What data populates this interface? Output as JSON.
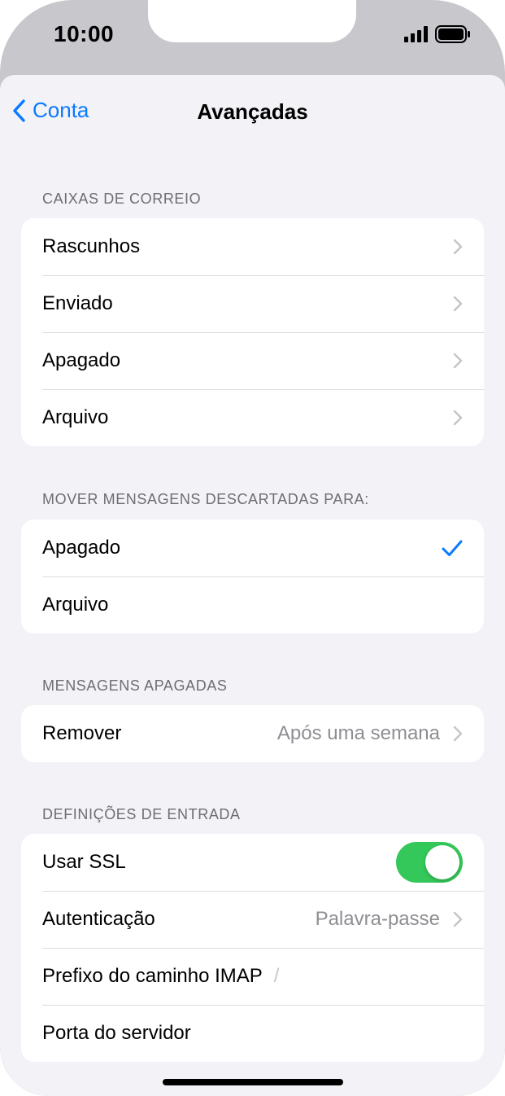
{
  "status_bar": {
    "time": "10:00"
  },
  "nav": {
    "back_label": "Conta",
    "title": "Avançadas"
  },
  "sections": [
    {
      "header": "CAIXAS DE CORREIO",
      "rows": [
        "Rascunhos",
        "Enviado",
        "Apagado",
        "Arquivo"
      ]
    },
    {
      "header": "MOVER MENSAGENS DESCARTADAS PARA:",
      "rows": [
        "Apagado",
        "Arquivo"
      ],
      "selected": "Apagado"
    },
    {
      "header": "MENSAGENS APAGADAS",
      "rows": [
        {
          "label": "Remover",
          "value": "Após uma semana"
        }
      ]
    },
    {
      "header": "DEFINIÇÕES DE ENTRADA",
      "rows": [
        {
          "label": "Usar SSL",
          "toggle_on": true
        },
        {
          "label": "Autenticação",
          "value": "Palavra-passe"
        },
        {
          "label": "Prefixo do caminho IMAP",
          "value": "/"
        },
        {
          "label": "Porta do servidor",
          "value": ""
        }
      ]
    }
  ],
  "colors": {
    "accent": "#0a7aff",
    "toggle_on": "#34c759",
    "background": "#f2f2f7"
  },
  "icons": [
    "chevron-left-icon",
    "chevron-right-icon",
    "checkmark-icon",
    "signal-icon",
    "battery-icon"
  ]
}
